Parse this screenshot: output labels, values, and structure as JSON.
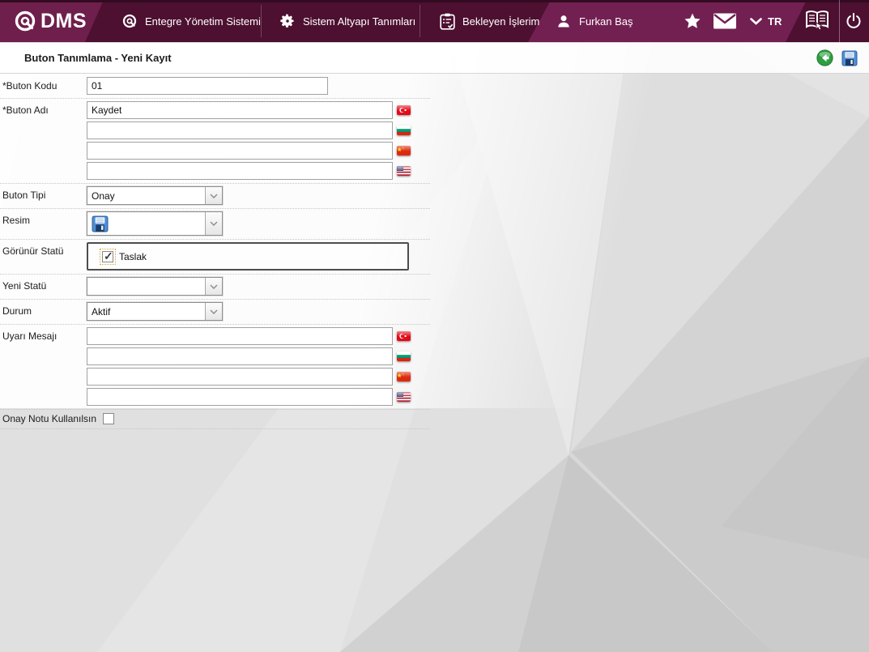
{
  "navbar": {
    "logo_text": "DMS",
    "menu": [
      {
        "label": "Entegre Yönetim Sistemi",
        "icon": "qdms-ring-icon"
      },
      {
        "label": "Sistem Altyapı Tanımları",
        "icon": "gear-icon"
      },
      {
        "label": "Bekleyen İşlerim",
        "icon": "clipboard-check-icon"
      }
    ],
    "user_name": "Furkan Baş",
    "language": "TR",
    "icons": [
      "star-icon",
      "mail-icon",
      "chevron-down-icon",
      "help-book-icon",
      "power-icon"
    ]
  },
  "toolbar": {
    "title": "Buton Tanımlama - Yeni Kayıt",
    "back_icon": "back-circle-icon",
    "save_icon": "save-floppy-icon"
  },
  "form": {
    "buton_kodu": {
      "label": "*Buton Kodu",
      "value": "01"
    },
    "buton_adi": {
      "label": "*Buton Adı",
      "values": [
        "Kaydet",
        "",
        "",
        ""
      ]
    },
    "buton_tipi": {
      "label": "Buton Tipi",
      "value": "Onay"
    },
    "resim": {
      "label": "Resim",
      "value": "",
      "icon": "save-floppy-icon"
    },
    "gorunur_statu": {
      "label": "Görünür Statü",
      "option": "Taslak",
      "checked": true
    },
    "yeni_statu": {
      "label": "Yeni Statü",
      "value": ""
    },
    "durum": {
      "label": "Durum",
      "value": "Aktif"
    },
    "uyari_mesaji": {
      "label": "Uyarı Mesajı",
      "values": [
        "",
        "",
        "",
        ""
      ]
    },
    "onay_notu": {
      "label": "Onay Notu Kullanılsın",
      "checked": false
    },
    "flag_order": [
      "turkey",
      "bulgaria",
      "china",
      "usa"
    ]
  },
  "colors": {
    "nav_dark": "#4d1031",
    "nav_light": "#722051",
    "back_green": "#2f9e41",
    "floppy_blue": "#4f8fd4",
    "focus_orange": "#e2a33c"
  }
}
